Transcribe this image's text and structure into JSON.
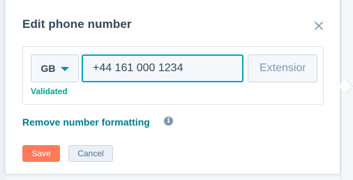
{
  "dialog": {
    "title": "Edit phone number",
    "close_icon": "close-icon"
  },
  "phone": {
    "country_code": "GB",
    "country_caret_icon": "caret-down-icon",
    "number_value": "+44 161 000 1234",
    "extension_placeholder": "Extension",
    "extension_value": "",
    "validation_status": "Validated"
  },
  "remove_formatting": {
    "label": "Remove number formatting",
    "info_icon": "info-icon",
    "info_glyph": "i"
  },
  "actions": {
    "save_label": "Save",
    "cancel_label": "Cancel"
  },
  "colors": {
    "accent_teal": "#00a4bd",
    "link_teal": "#007a8c",
    "validated_green": "#00a78d",
    "save_orange": "#ff7a59",
    "text_dark": "#33475b"
  }
}
